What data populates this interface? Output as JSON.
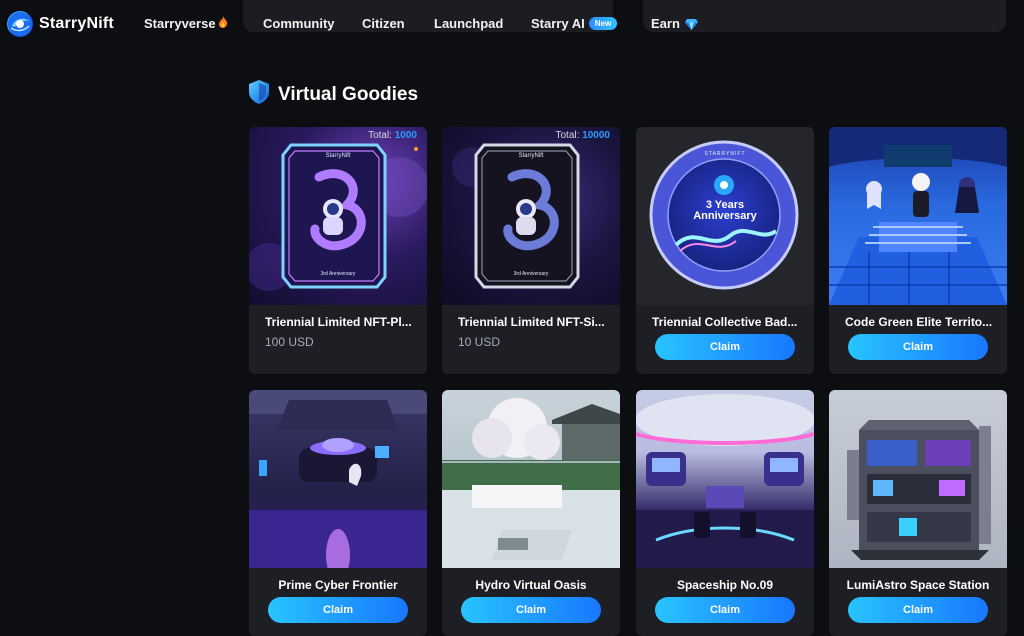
{
  "app": {
    "name": "StarryNift"
  },
  "nav": {
    "items": [
      {
        "label": "Starryverse",
        "suffix": "fire"
      },
      {
        "label": "Community"
      },
      {
        "label": "Citizen"
      },
      {
        "label": "Launchpad"
      },
      {
        "label": "Starry AI",
        "badge": "New"
      },
      {
        "label": "Earn",
        "suffix": "diamond"
      }
    ]
  },
  "section": {
    "title": "Virtual Goodies",
    "icon": "shield-icon"
  },
  "colors": {
    "accent": "#1e8fff",
    "button_from": "#28c4ff",
    "button_to": "#1877ff",
    "card_bg": "#1d1f24",
    "page_bg": "#0d0e11"
  },
  "cards": [
    {
      "name": "Triennial Limited NFT-Pl...",
      "price": "100 USD",
      "total_label": "Total:",
      "total": "1000",
      "image": "purple-3rd-anniversary-card"
    },
    {
      "name": "Triennial Limited NFT-Si...",
      "price": "10 USD",
      "total_label": "Total:",
      "total": "10000",
      "image": "silver-3rd-anniversary-card"
    },
    {
      "name": "Triennial Collective Bad...",
      "button": "Claim",
      "image": "3-years-anniversary-badge",
      "badge_text_1": "3 Years",
      "badge_text_2": "Anniversary",
      "badge_ring": "STARRYNIFT"
    },
    {
      "name": "Code Green Elite Territo...",
      "button": "Claim",
      "image": "code-green-hall"
    },
    {
      "name": "Prime Cyber Frontier",
      "button": "Claim",
      "image": "cyber-room"
    },
    {
      "name": "Hydro Virtual Oasis",
      "button": "Claim",
      "image": "garden-oasis"
    },
    {
      "name": "Spaceship No.09",
      "button": "Claim",
      "image": "spaceship-bridge"
    },
    {
      "name": "LumiAstro Space Station",
      "button": "Claim",
      "image": "space-station-building"
    }
  ],
  "card_art_labels": {
    "brand": "StarryNift",
    "anniversary": "3rd Anniversary"
  }
}
